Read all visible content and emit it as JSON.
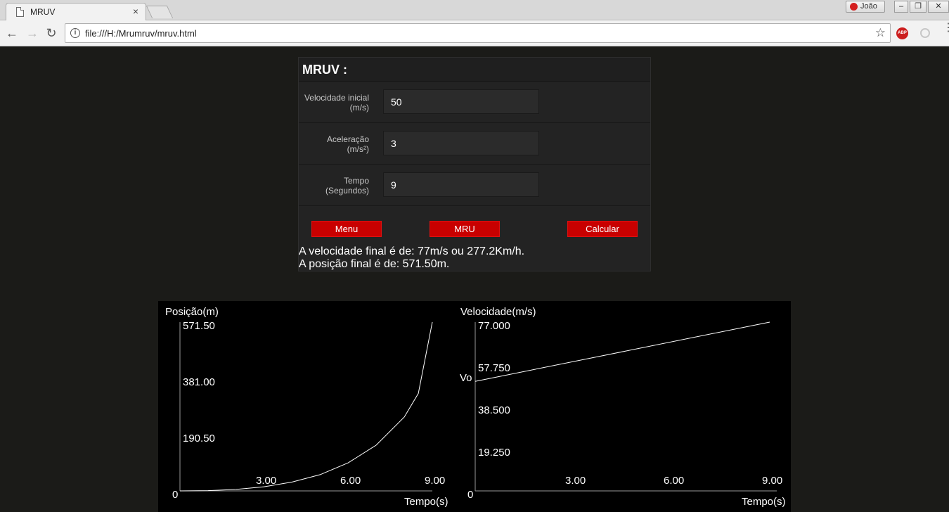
{
  "browser": {
    "tab_title": "MRUV",
    "tab_close": "×",
    "profile_name": "João",
    "url": "file:///H:/Mrumruv/mruv.html",
    "abp_label": "ABP"
  },
  "form": {
    "title": "MRUV :",
    "fields": [
      {
        "label_line1": "Velocidade inicial",
        "label_line2": "(m/s)",
        "value": "50"
      },
      {
        "label_line1": "Aceleração",
        "label_line2": "(m/s²)",
        "value": "3"
      },
      {
        "label_line1": "Tempo",
        "label_line2": "(Segundos)",
        "value": "9"
      }
    ],
    "buttons": {
      "menu": "Menu",
      "mru": "MRU",
      "calcular": "Calcular"
    },
    "result_velocity": "A velocidade final é de: 77m/s ou 277.2Km/h.",
    "result_position": "A posição final é de: 571.50m.",
    "colors": {
      "button": "#c80000",
      "panel": "#232323",
      "background": "#1b1b18"
    }
  },
  "chart_data": [
    {
      "type": "line",
      "title": "",
      "ylabel": "Posição(m)",
      "xlabel": "Tempo(s)",
      "origin_label": "0",
      "y_tick_labels": [
        "571.50",
        "381.00",
        "190.50"
      ],
      "x_tick_labels": [
        "3.00",
        "6.00",
        "9.00"
      ],
      "xlim": [
        0,
        9
      ],
      "ylim": [
        0,
        571.5
      ],
      "x": [
        0,
        1,
        2,
        3,
        4,
        5,
        6,
        7,
        8,
        8.5,
        9
      ],
      "y": [
        0,
        1,
        5,
        14,
        30,
        55,
        95,
        155,
        250,
        330,
        571.5
      ],
      "line_color": "#ffffff",
      "grid": false
    },
    {
      "type": "line",
      "title": "",
      "ylabel": "Velocidade(m/s)",
      "xlabel": "Tempo(s)",
      "origin_label": "0",
      "vo_label": "Vo",
      "y_tick_labels": [
        "77.000",
        "57.750",
        "38.500",
        "19.250"
      ],
      "x_tick_labels": [
        "3.00",
        "6.00",
        "9.00"
      ],
      "xlim": [
        0,
        9
      ],
      "ylim": [
        0,
        77
      ],
      "x": [
        0,
        9
      ],
      "y": [
        50,
        77
      ],
      "line_color": "#ffffff",
      "grid": false
    }
  ]
}
